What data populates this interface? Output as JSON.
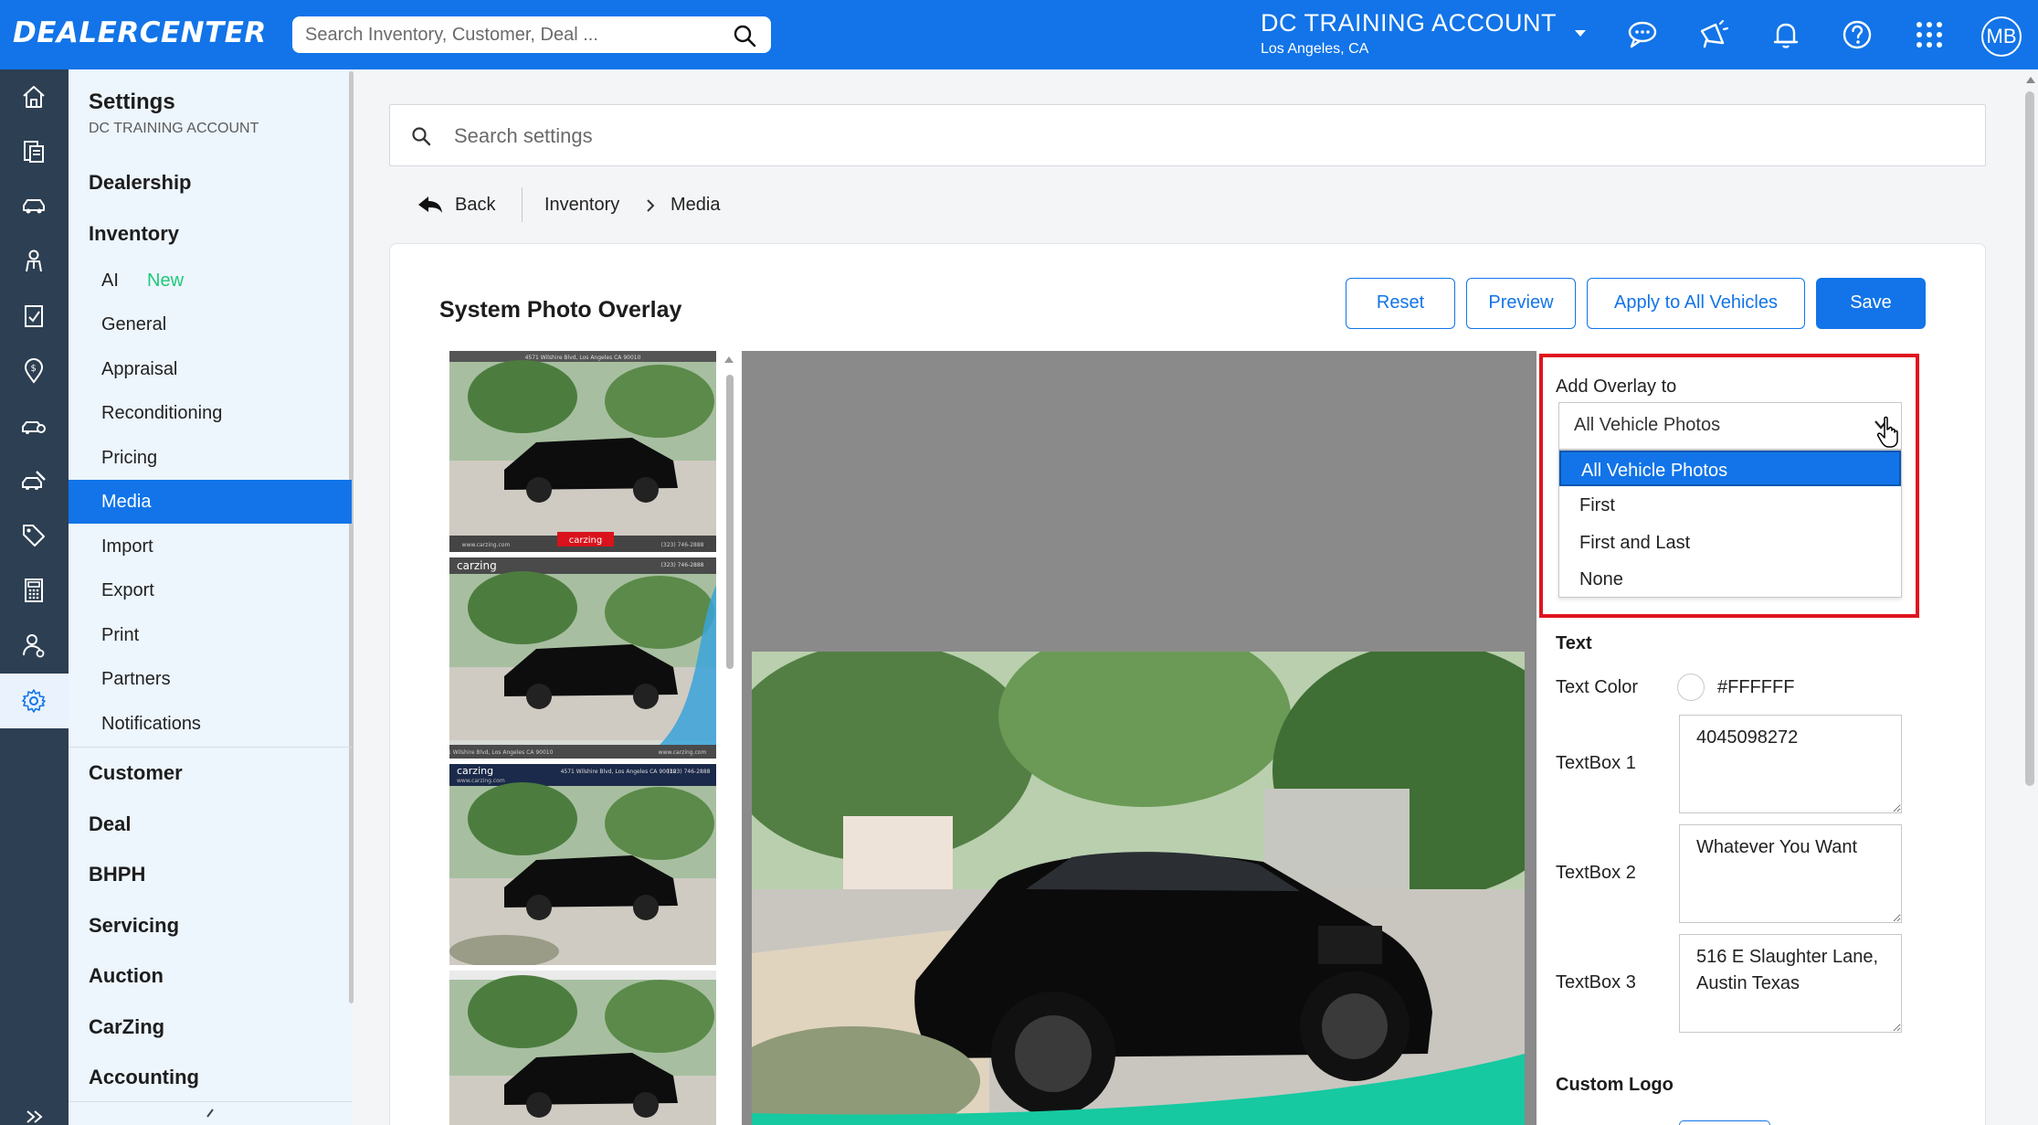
{
  "header": {
    "logo": "DEALERCENTER",
    "search_placeholder": "Search Inventory, Customer, Deal ...",
    "account_name": "DC TRAINING ACCOUNT",
    "account_location": "Los Angeles, CA",
    "avatar_initials": "MB",
    "icons": [
      "search-icon",
      "chat-icon",
      "megaphone-icon",
      "bell-icon",
      "help-icon",
      "apps-grid-icon"
    ],
    "color": "#1274e8"
  },
  "rail": {
    "items": [
      "home-icon",
      "deals-icon",
      "car-icon",
      "customer-icon",
      "forms-icon",
      "location-dollar-icon",
      "car-service-icon",
      "car-auction-icon",
      "tag-icon",
      "calculator-icon",
      "user-settings-icon",
      "gear-icon"
    ],
    "active": "gear-icon",
    "color": "#2d3f52"
  },
  "sidebar": {
    "title": "Settings",
    "subtitle": "DC TRAINING ACCOUNT",
    "sections": {
      "dealership": "Dealership",
      "inventory": "Inventory",
      "customer": "Customer",
      "deal": "Deal",
      "bhph": "BHPH",
      "servicing": "Servicing",
      "auction": "Auction",
      "carzing": "CarZing",
      "accounting": "Accounting"
    },
    "inventory_items": [
      "AI",
      "General",
      "Appraisal",
      "Reconditioning",
      "Pricing",
      "Media",
      "Import",
      "Export",
      "Print",
      "Partners",
      "Notifications"
    ],
    "new_tag": "New",
    "active_item": "Media"
  },
  "main": {
    "search_placeholder": "Search settings",
    "back_label": "Back",
    "breadcrumb": [
      "Inventory",
      "Media"
    ],
    "title": "System Photo Overlay",
    "buttons": {
      "reset": "Reset",
      "preview": "Preview",
      "apply_all": "Apply to All Vehicles",
      "save": "Save"
    },
    "thumbnail_texts": {
      "brand": "carzing",
      "address": "4571 Wilshire Blvd, Los Angeles CA 90010",
      "phone": "(323) 746-2888",
      "website": "www.carzing.com"
    }
  },
  "overlay_panel": {
    "label": "Add Overlay to",
    "selected": "All Vehicle Photos",
    "options": [
      "All Vehicle Photos",
      "First",
      "First and Last",
      "None"
    ],
    "highlight_color": "#e0141e"
  },
  "text_section": {
    "heading": "Text",
    "color_label": "Text Color",
    "color_value": "#FFFFFF",
    "textbox1_label": "TextBox 1",
    "textbox1_value": "4045098272",
    "textbox2_label": "TextBox 2",
    "textbox2_value": "Whatever You Want",
    "textbox3_label": "TextBox 3",
    "textbox3_value": "516 E Slaughter Lane, Austin Texas",
    "custom_logo": "Custom Logo"
  }
}
